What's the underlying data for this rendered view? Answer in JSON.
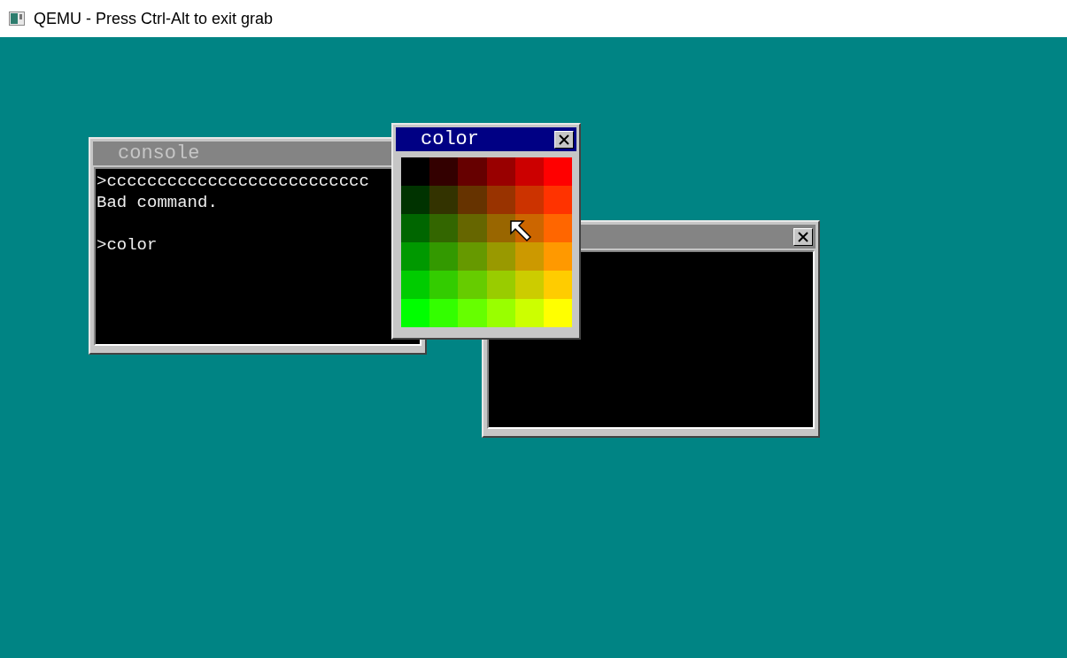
{
  "title_bar": {
    "title": "QEMU - Press Ctrl-Alt to exit grab"
  },
  "windows": [
    {
      "title": "console",
      "active": false,
      "close_button": false,
      "lines": [
        {
          "kind": "text",
          "text": ">cccccccccccccccccccccccccc"
        },
        {
          "kind": "text",
          "text": "Bad command."
        },
        {
          "kind": "blank"
        },
        {
          "kind": "text",
          "text": ">color"
        }
      ]
    },
    {
      "active": false,
      "close_button": true
    },
    {
      "title": "color",
      "active": true,
      "close_button": true,
      "palette": [
        {
          "color": "#000000"
        },
        {
          "color": "#330000"
        },
        {
          "color": "#660000"
        },
        {
          "color": "#990000"
        },
        {
          "color": "#cc0000"
        },
        {
          "color": "#ff0000"
        },
        {
          "color": "#003300"
        },
        {
          "color": "#333300"
        },
        {
          "color": "#663300"
        },
        {
          "color": "#993300"
        },
        {
          "color": "#cc3300"
        },
        {
          "color": "#ff3300"
        },
        {
          "color": "#006600"
        },
        {
          "color": "#336600"
        },
        {
          "color": "#666600"
        },
        {
          "color": "#996600"
        },
        {
          "color": "#cc6600"
        },
        {
          "color": "#ff6600"
        },
        {
          "color": "#009900"
        },
        {
          "color": "#339900"
        },
        {
          "color": "#669900"
        },
        {
          "color": "#999900"
        },
        {
          "color": "#cc9900"
        },
        {
          "color": "#ff9900"
        },
        {
          "color": "#00cc00"
        },
        {
          "color": "#33cc00"
        },
        {
          "color": "#66cc00"
        },
        {
          "color": "#99cc00"
        },
        {
          "color": "#cccc00"
        },
        {
          "color": "#ffcc00"
        },
        {
          "color": "#00ff00"
        },
        {
          "color": "#33ff00"
        },
        {
          "color": "#66ff00"
        },
        {
          "color": "#99ff00"
        },
        {
          "color": "#ccff00"
        },
        {
          "color": "#ffff00"
        }
      ]
    }
  ]
}
